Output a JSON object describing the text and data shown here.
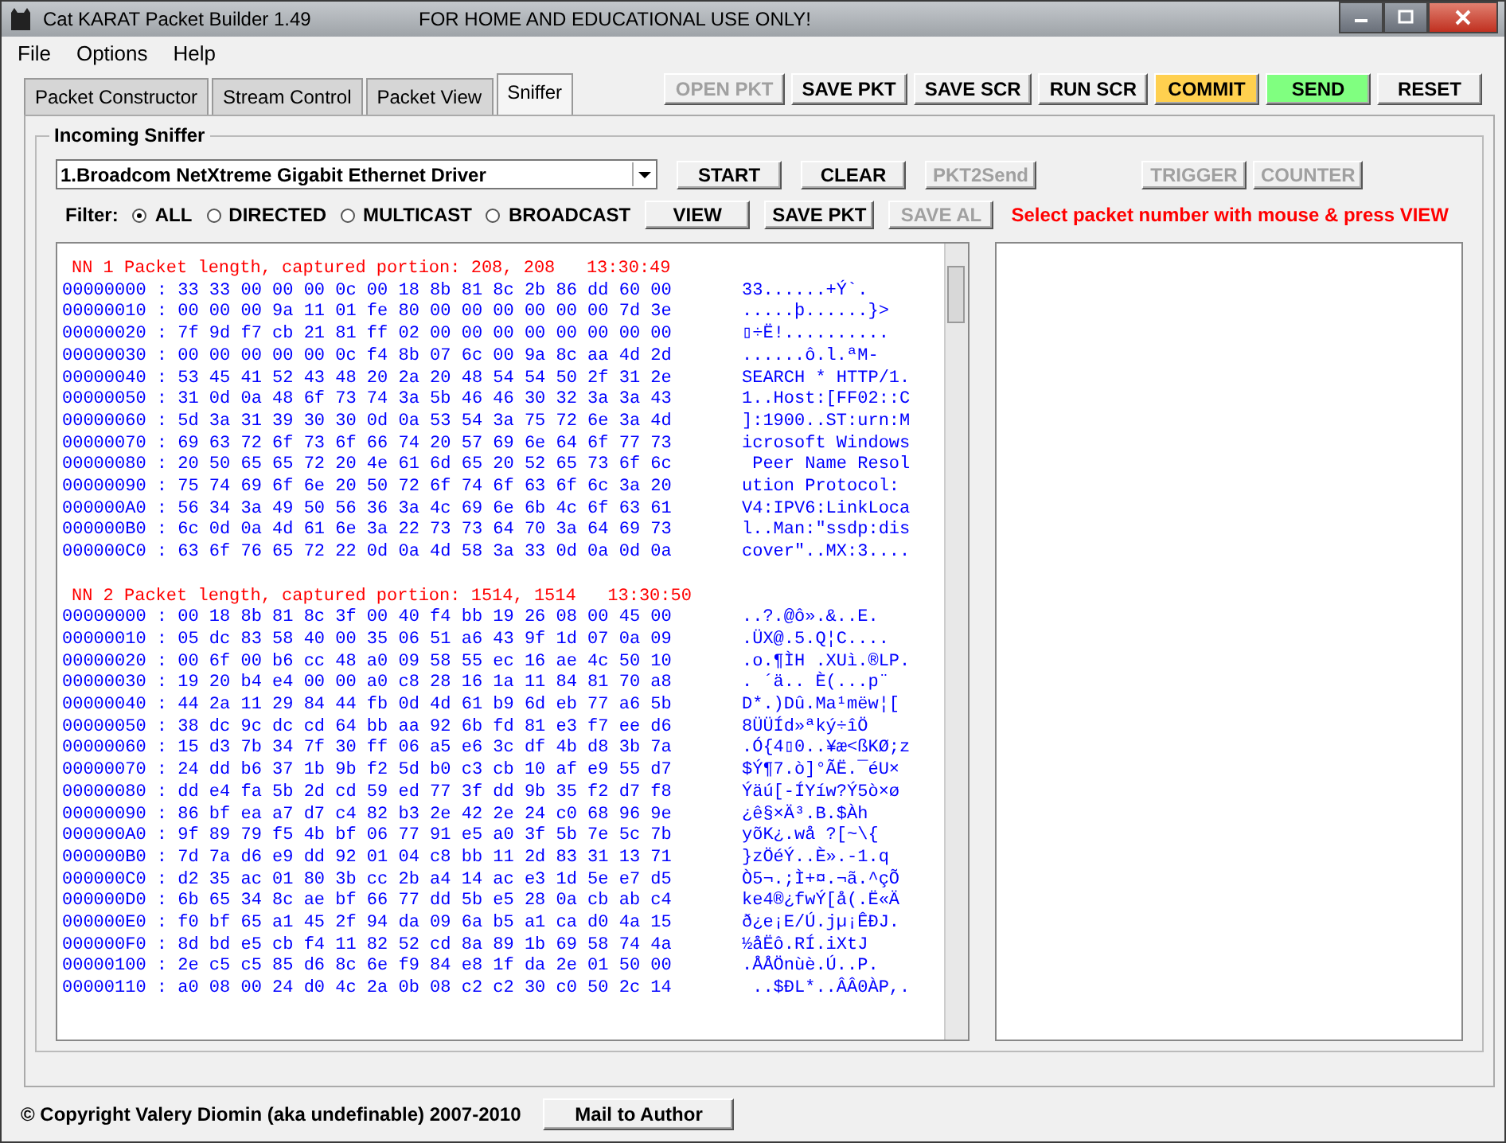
{
  "window": {
    "title": "Cat KARAT Packet Builder 1.49",
    "notice": "FOR HOME AND EDUCATIONAL USE ONLY!"
  },
  "menu": [
    "File",
    "Options",
    "Help"
  ],
  "tabs": [
    {
      "label": "Packet Constructor",
      "selected": false
    },
    {
      "label": "Stream Control",
      "selected": false
    },
    {
      "label": "Packet View",
      "selected": false
    },
    {
      "label": "Sniffer",
      "selected": true
    }
  ],
  "toolbar": [
    {
      "label": "OPEN PKT",
      "disabled": true
    },
    {
      "label": "SAVE PKT",
      "disabled": false
    },
    {
      "label": "SAVE SCR",
      "disabled": false
    },
    {
      "label": "RUN SCR",
      "disabled": false
    },
    {
      "label": "COMMIT",
      "disabled": false,
      "color": "#ffd04f"
    },
    {
      "label": "SEND",
      "disabled": false,
      "color": "#80ff80"
    },
    {
      "label": "RESET",
      "disabled": false
    }
  ],
  "sniffer": {
    "title": "Incoming Sniffer",
    "adapter": "1.Broadcom NetXtreme Gigabit Ethernet Driver",
    "row1_buttons": [
      {
        "label": "START",
        "disabled": false
      },
      {
        "label": "CLEAR",
        "disabled": false
      },
      {
        "label": "PKT2Send",
        "disabled": true
      }
    ],
    "row1_right": [
      {
        "label": "TRIGGER",
        "disabled": true
      },
      {
        "label": "COUNTER",
        "disabled": true
      }
    ],
    "filter_label": "Filter:",
    "filters": [
      {
        "label": "ALL",
        "selected": true
      },
      {
        "label": "DIRECTED",
        "selected": false
      },
      {
        "label": "MULTICAST",
        "selected": false
      },
      {
        "label": "BROADCAST",
        "selected": false
      }
    ],
    "row2_buttons": [
      {
        "label": "VIEW",
        "disabled": false
      },
      {
        "label": "SAVE PKT",
        "disabled": false
      },
      {
        "label": "SAVE AL",
        "disabled": true
      }
    ],
    "hint": "Select packet number with mouse & press VIEW",
    "packets": [
      {
        "header": "NN 1 Packet length, captured portion: 208, 208   13:30:49",
        "rows": [
          {
            "hex": "00000000 : 33 33 00 00 00 0c 00 18 8b 81 8c 2b 86 dd 60 00",
            "ascii": "33......+Ý`."
          },
          {
            "hex": "00000010 : 00 00 00 9a 11 01 fe 80 00 00 00 00 00 00 7d 3e",
            "ascii": ".....þ......}>"
          },
          {
            "hex": "00000020 : 7f 9d f7 cb 21 81 ff 02 00 00 00 00 00 00 00 00",
            "ascii": "▯÷Ë!.........."
          },
          {
            "hex": "00000030 : 00 00 00 00 00 0c f4 8b 07 6c 00 9a 8c aa 4d 2d",
            "ascii": "......ô.l.ªM-"
          },
          {
            "hex": "00000040 : 53 45 41 52 43 48 20 2a 20 48 54 54 50 2f 31 2e",
            "ascii": "SEARCH * HTTP/1."
          },
          {
            "hex": "00000050 : 31 0d 0a 48 6f 73 74 3a 5b 46 46 30 32 3a 3a 43",
            "ascii": "1..Host:[FF02::C"
          },
          {
            "hex": "00000060 : 5d 3a 31 39 30 30 0d 0a 53 54 3a 75 72 6e 3a 4d",
            "ascii": "]:1900..ST:urn:M"
          },
          {
            "hex": "00000070 : 69 63 72 6f 73 6f 66 74 20 57 69 6e 64 6f 77 73",
            "ascii": "icrosoft Windows"
          },
          {
            "hex": "00000080 : 20 50 65 65 72 20 4e 61 6d 65 20 52 65 73 6f 6c",
            "ascii": " Peer Name Resol"
          },
          {
            "hex": "00000090 : 75 74 69 6f 6e 20 50 72 6f 74 6f 63 6f 6c 3a 20",
            "ascii": "ution Protocol:"
          },
          {
            "hex": "000000A0 : 56 34 3a 49 50 56 36 3a 4c 69 6e 6b 4c 6f 63 61",
            "ascii": "V4:IPV6:LinkLoca"
          },
          {
            "hex": "000000B0 : 6c 0d 0a 4d 61 6e 3a 22 73 73 64 70 3a 64 69 73",
            "ascii": "l..Man:\"ssdp:dis"
          },
          {
            "hex": "000000C0 : 63 6f 76 65 72 22 0d 0a 4d 58 3a 33 0d 0a 0d 0a",
            "ascii": "cover\"..MX:3...."
          }
        ]
      },
      {
        "header": "NN 2 Packet length, captured portion: 1514, 1514   13:30:50",
        "rows": [
          {
            "hex": "00000000 : 00 18 8b 81 8c 3f 00 40 f4 bb 19 26 08 00 45 00",
            "ascii": "..?.@ô».&..E."
          },
          {
            "hex": "00000010 : 05 dc 83 58 40 00 35 06 51 a6 43 9f 1d 07 0a 09",
            "ascii": ".ÜX@.5.Q¦C...."
          },
          {
            "hex": "00000020 : 00 6f 00 b6 cc 48 a0 09 58 55 ec 16 ae 4c 50 10",
            "ascii": ".o.¶ÌH .XUì.®LP."
          },
          {
            "hex": "00000030 : 19 20 b4 e4 00 00 a0 c8 28 16 1a 11 84 81 70 a8",
            "ascii": ". ´ä.. È(...p¨"
          },
          {
            "hex": "00000040 : 44 2a 11 29 84 44 fb 0d 4d 61 b9 6d eb 77 a6 5b",
            "ascii": "D*.)Dû.Ma¹mëw¦["
          },
          {
            "hex": "00000050 : 38 dc 9c dc cd 64 bb aa 92 6b fd 81 e3 f7 ee d6",
            "ascii": "8ÜÜÍd»ªký÷îÖ"
          },
          {
            "hex": "00000060 : 15 d3 7b 34 7f 30 ff 06 a5 e6 3c df 4b d8 3b 7a",
            "ascii": ".Ó{4▯0..¥æ<ßKØ;z"
          },
          {
            "hex": "00000070 : 24 dd b6 37 1b 9b f2 5d b0 c3 cb 10 af e9 55 d7",
            "ascii": "$Ý¶7.ò]°ÃË.¯éU×"
          },
          {
            "hex": "00000080 : dd e4 fa 5b 2d cd 59 ed 77 3f dd 9b 35 f2 d7 f8",
            "ascii": "Ýäú[-ÍYíw?Ý5ò×ø"
          },
          {
            "hex": "00000090 : 86 bf ea a7 d7 c4 82 b3 2e 42 2e 24 c0 68 96 9e",
            "ascii": "¿ê§×Ä³.B.$Àh"
          },
          {
            "hex": "000000A0 : 9f 89 79 f5 4b bf 06 77 91 e5 a0 3f 5b 7e 5c 7b",
            "ascii": "yõK¿.wå ?[~\\{"
          },
          {
            "hex": "000000B0 : 7d 7a d6 e9 dd 92 01 04 c8 bb 11 2d 83 31 13 71",
            "ascii": "}zÖéÝ..È».-1.q"
          },
          {
            "hex": "000000C0 : d2 35 ac 01 80 3b cc 2b a4 14 ac e3 1d 5e e7 d5",
            "ascii": "Ò5¬.;Ì+¤.¬ã.^çÕ"
          },
          {
            "hex": "000000D0 : 6b 65 34 8c ae bf 66 77 dd 5b e5 28 0a cb ab c4",
            "ascii": "ke4®¿fwÝ[å(.Ë«Ä"
          },
          {
            "hex": "000000E0 : f0 bf 65 a1 45 2f 94 da 09 6a b5 a1 ca d0 4a 15",
            "ascii": "ð¿e¡E/Ú.jµ¡ÊÐJ."
          },
          {
            "hex": "000000F0 : 8d bd e5 cb f4 11 82 52 cd 8a 89 1b 69 58 74 4a",
            "ascii": "½åËô.RÍ.iXtJ"
          },
          {
            "hex": "00000100 : 2e c5 c5 85 d6 8c 6e f9 84 e8 1f da 2e 01 50 00",
            "ascii": ".ÅÅÖnùè.Ú..P."
          },
          {
            "hex": "00000110 : a0 08 00 24 d0 4c 2a 0b 08 c2 c2 30 c0 50 2c 14",
            "ascii": " ..$ÐL*..ÂÂ0ÀP,."
          }
        ]
      }
    ]
  },
  "footer": {
    "copyright": "© Copyright Valery Diomin (aka undefinable) 2007-2010",
    "button": "Mail to Author"
  }
}
